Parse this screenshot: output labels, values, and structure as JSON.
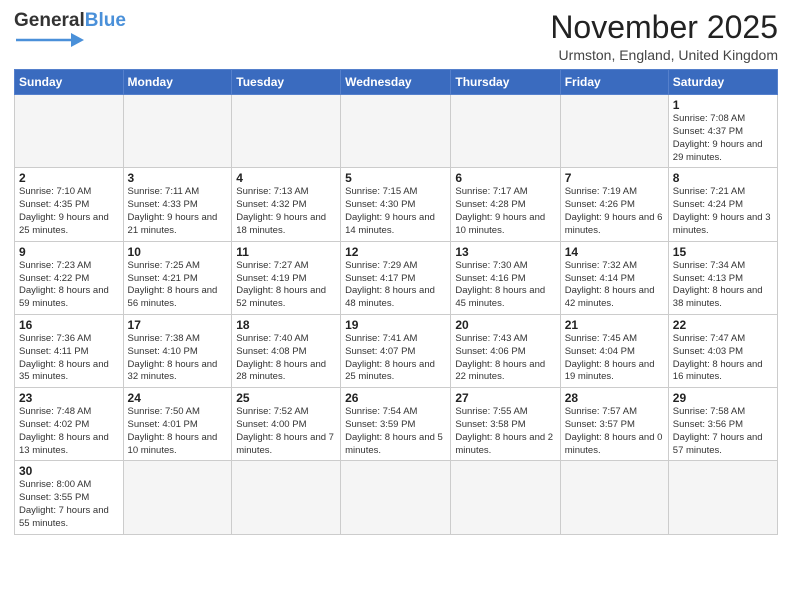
{
  "header": {
    "logo_text_general": "General",
    "logo_text_blue": "Blue",
    "title": "November 2025",
    "subtitle": "Urmston, England, United Kingdom"
  },
  "weekdays": [
    "Sunday",
    "Monday",
    "Tuesday",
    "Wednesday",
    "Thursday",
    "Friday",
    "Saturday"
  ],
  "weeks": [
    [
      {
        "day": "",
        "info": ""
      },
      {
        "day": "",
        "info": ""
      },
      {
        "day": "",
        "info": ""
      },
      {
        "day": "",
        "info": ""
      },
      {
        "day": "",
        "info": ""
      },
      {
        "day": "",
        "info": ""
      },
      {
        "day": "1",
        "info": "Sunrise: 7:08 AM\nSunset: 4:37 PM\nDaylight: 9 hours and 29 minutes."
      }
    ],
    [
      {
        "day": "2",
        "info": "Sunrise: 7:10 AM\nSunset: 4:35 PM\nDaylight: 9 hours and 25 minutes."
      },
      {
        "day": "3",
        "info": "Sunrise: 7:11 AM\nSunset: 4:33 PM\nDaylight: 9 hours and 21 minutes."
      },
      {
        "day": "4",
        "info": "Sunrise: 7:13 AM\nSunset: 4:32 PM\nDaylight: 9 hours and 18 minutes."
      },
      {
        "day": "5",
        "info": "Sunrise: 7:15 AM\nSunset: 4:30 PM\nDaylight: 9 hours and 14 minutes."
      },
      {
        "day": "6",
        "info": "Sunrise: 7:17 AM\nSunset: 4:28 PM\nDaylight: 9 hours and 10 minutes."
      },
      {
        "day": "7",
        "info": "Sunrise: 7:19 AM\nSunset: 4:26 PM\nDaylight: 9 hours and 6 minutes."
      },
      {
        "day": "8",
        "info": "Sunrise: 7:21 AM\nSunset: 4:24 PM\nDaylight: 9 hours and 3 minutes."
      }
    ],
    [
      {
        "day": "9",
        "info": "Sunrise: 7:23 AM\nSunset: 4:22 PM\nDaylight: 8 hours and 59 minutes."
      },
      {
        "day": "10",
        "info": "Sunrise: 7:25 AM\nSunset: 4:21 PM\nDaylight: 8 hours and 56 minutes."
      },
      {
        "day": "11",
        "info": "Sunrise: 7:27 AM\nSunset: 4:19 PM\nDaylight: 8 hours and 52 minutes."
      },
      {
        "day": "12",
        "info": "Sunrise: 7:29 AM\nSunset: 4:17 PM\nDaylight: 8 hours and 48 minutes."
      },
      {
        "day": "13",
        "info": "Sunrise: 7:30 AM\nSunset: 4:16 PM\nDaylight: 8 hours and 45 minutes."
      },
      {
        "day": "14",
        "info": "Sunrise: 7:32 AM\nSunset: 4:14 PM\nDaylight: 8 hours and 42 minutes."
      },
      {
        "day": "15",
        "info": "Sunrise: 7:34 AM\nSunset: 4:13 PM\nDaylight: 8 hours and 38 minutes."
      }
    ],
    [
      {
        "day": "16",
        "info": "Sunrise: 7:36 AM\nSunset: 4:11 PM\nDaylight: 8 hours and 35 minutes."
      },
      {
        "day": "17",
        "info": "Sunrise: 7:38 AM\nSunset: 4:10 PM\nDaylight: 8 hours and 32 minutes."
      },
      {
        "day": "18",
        "info": "Sunrise: 7:40 AM\nSunset: 4:08 PM\nDaylight: 8 hours and 28 minutes."
      },
      {
        "day": "19",
        "info": "Sunrise: 7:41 AM\nSunset: 4:07 PM\nDaylight: 8 hours and 25 minutes."
      },
      {
        "day": "20",
        "info": "Sunrise: 7:43 AM\nSunset: 4:06 PM\nDaylight: 8 hours and 22 minutes."
      },
      {
        "day": "21",
        "info": "Sunrise: 7:45 AM\nSunset: 4:04 PM\nDaylight: 8 hours and 19 minutes."
      },
      {
        "day": "22",
        "info": "Sunrise: 7:47 AM\nSunset: 4:03 PM\nDaylight: 8 hours and 16 minutes."
      }
    ],
    [
      {
        "day": "23",
        "info": "Sunrise: 7:48 AM\nSunset: 4:02 PM\nDaylight: 8 hours and 13 minutes."
      },
      {
        "day": "24",
        "info": "Sunrise: 7:50 AM\nSunset: 4:01 PM\nDaylight: 8 hours and 10 minutes."
      },
      {
        "day": "25",
        "info": "Sunrise: 7:52 AM\nSunset: 4:00 PM\nDaylight: 8 hours and 7 minutes."
      },
      {
        "day": "26",
        "info": "Sunrise: 7:54 AM\nSunset: 3:59 PM\nDaylight: 8 hours and 5 minutes."
      },
      {
        "day": "27",
        "info": "Sunrise: 7:55 AM\nSunset: 3:58 PM\nDaylight: 8 hours and 2 minutes."
      },
      {
        "day": "28",
        "info": "Sunrise: 7:57 AM\nSunset: 3:57 PM\nDaylight: 8 hours and 0 minutes."
      },
      {
        "day": "29",
        "info": "Sunrise: 7:58 AM\nSunset: 3:56 PM\nDaylight: 7 hours and 57 minutes."
      }
    ],
    [
      {
        "day": "30",
        "info": "Sunrise: 8:00 AM\nSunset: 3:55 PM\nDaylight: 7 hours and 55 minutes."
      },
      {
        "day": "",
        "info": ""
      },
      {
        "day": "",
        "info": ""
      },
      {
        "day": "",
        "info": ""
      },
      {
        "day": "",
        "info": ""
      },
      {
        "day": "",
        "info": ""
      },
      {
        "day": "",
        "info": ""
      }
    ]
  ]
}
